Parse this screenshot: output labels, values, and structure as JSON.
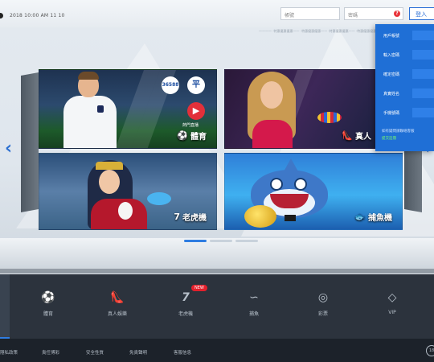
{
  "header": {
    "clock": "2018 10:00   AM  11  10",
    "account_placeholder": "帳號",
    "password_placeholder": "密碼",
    "login_label": "登入"
  },
  "marquee": "一一一一 ·特惠優惠優惠一一 ·特惠優惠優惠一一 ·特惠優惠優惠一一 ·特惠優惠優惠一一",
  "login_panel": {
    "rows": [
      {
        "label": "用戶帳號"
      },
      {
        "label": "輸入密碼"
      },
      {
        "label": "確定密碼"
      },
      {
        "label": "真實姓名"
      },
      {
        "label": "手機號碼"
      }
    ],
    "link_1": "如有疑問請聯絡客服",
    "link_2": "提交註冊"
  },
  "cards": {
    "sports": {
      "label": "體育",
      "badge_a": "36588",
      "badge_b": "平",
      "cam_text": "熱門直播"
    },
    "live": {
      "label": "真人"
    },
    "slots": {
      "label": "老虎機",
      "glyph": "7"
    },
    "fish": {
      "label": "捕魚機"
    }
  },
  "nav": {
    "items": [
      {
        "label": "體育",
        "icon": "soccer-ball-icon"
      },
      {
        "label": "真人娛樂",
        "icon": "high-heel-icon"
      },
      {
        "label": "老虎機",
        "icon": "slot-seven-icon"
      },
      {
        "label": "捕魚",
        "icon": "fish-icon"
      },
      {
        "label": "彩票",
        "icon": "lottery-ball-icon"
      },
      {
        "label": "VIP",
        "icon": "diamond-icon"
      }
    ],
    "new_badge": "NEW"
  },
  "footer": {
    "links": [
      "隱私政策",
      "責任博彩",
      "安全性質",
      "免責聲明",
      "客服信息"
    ],
    "age_badge": "18"
  },
  "colors": {
    "accent": "#2f7de1",
    "panel_blue": "#1f6fd6",
    "nav_bg": "#2c333d",
    "badge_red": "#e4202c"
  }
}
